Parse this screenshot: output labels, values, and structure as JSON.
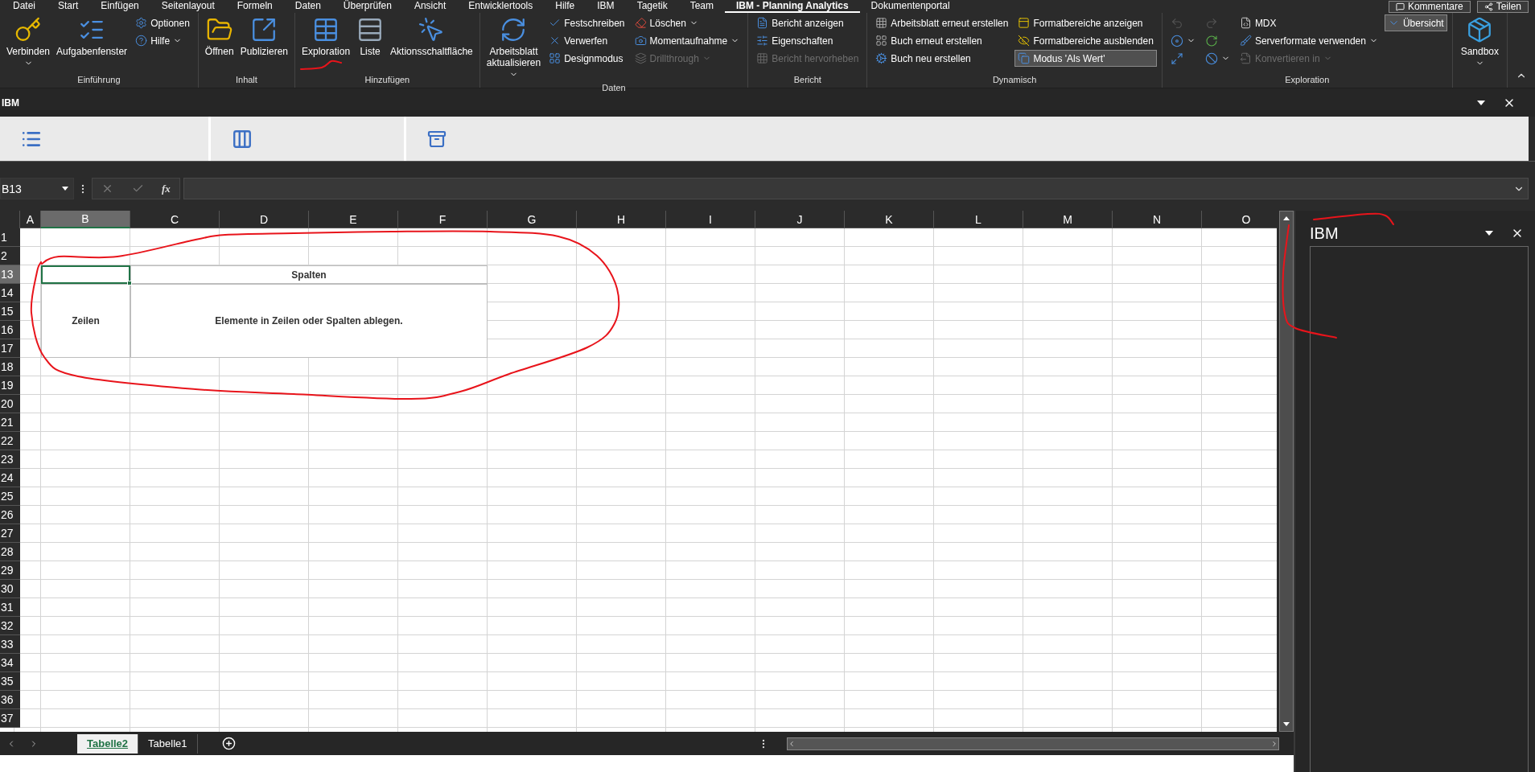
{
  "menu_tabs": [
    {
      "label": "Datei",
      "selected": false
    },
    {
      "label": "Start",
      "selected": false
    },
    {
      "label": "Einfügen",
      "selected": false
    },
    {
      "label": "Seitenlayout",
      "selected": false
    },
    {
      "label": "Formeln",
      "selected": false
    },
    {
      "label": "Daten",
      "selected": false
    },
    {
      "label": "Überprüfen",
      "selected": false
    },
    {
      "label": "Ansicht",
      "selected": false
    },
    {
      "label": "Entwicklertools",
      "selected": false
    },
    {
      "label": "Hilfe",
      "selected": false
    },
    {
      "label": "IBM",
      "selected": false
    },
    {
      "label": "Tagetik",
      "selected": false
    },
    {
      "label": "Team",
      "selected": false
    },
    {
      "label": "IBM - Planning Analytics",
      "selected": true
    },
    {
      "label": "Dokumentenportal",
      "selected": false
    }
  ],
  "top_buttons": [
    "Kommentare",
    "Teilen"
  ],
  "ribbon": {
    "groups": [
      {
        "label": "Einführung",
        "columns": [
          {
            "kind": "large",
            "items": [
              {
                "label": "Verbinden",
                "dropdown": true,
                "disabled": false
              }
            ]
          },
          {
            "kind": "large",
            "items": [
              {
                "label": "Aufgabenfenster",
                "dropdown": false,
                "disabled": false
              }
            ]
          },
          {
            "kind": "stack",
            "items": [
              {
                "label": "Optionen",
                "dropdown": false,
                "disabled": false
              },
              {
                "label": "Hilfe",
                "dropdown": true,
                "disabled": false
              }
            ]
          }
        ]
      },
      {
        "label": "Inhalt",
        "columns": [
          {
            "kind": "large",
            "items": [
              {
                "label": "Öffnen",
                "dropdown": false,
                "disabled": false
              }
            ]
          },
          {
            "kind": "large",
            "items": [
              {
                "label": "Publizieren",
                "dropdown": false,
                "disabled": false
              }
            ]
          }
        ]
      },
      {
        "label": "Hinzufügen",
        "columns": [
          {
            "kind": "large",
            "items": [
              {
                "label": "Exploration",
                "dropdown": false,
                "disabled": false
              }
            ]
          },
          {
            "kind": "large",
            "items": [
              {
                "label": "Liste",
                "dropdown": false,
                "disabled": false
              }
            ]
          },
          {
            "kind": "large",
            "items": [
              {
                "label": "Aktionsschaltfläche",
                "dropdown": false,
                "disabled": false
              }
            ]
          }
        ]
      },
      {
        "label": "Daten",
        "columns": [
          {
            "kind": "large",
            "items": [
              {
                "label": "Arbeitsblatt aktualisieren",
                "dropdown": true,
                "disabled": false
              }
            ]
          },
          {
            "kind": "stack",
            "items": [
              {
                "label": "Festschreiben",
                "dropdown": false,
                "disabled": false
              },
              {
                "label": "Verwerfen",
                "dropdown": false,
                "disabled": false
              },
              {
                "label": "Designmodus",
                "dropdown": false,
                "disabled": false
              }
            ]
          },
          {
            "kind": "stack",
            "items": [
              {
                "label": "Löschen",
                "dropdown": true,
                "disabled": false
              },
              {
                "label": "Momentaufnahme",
                "dropdown": true,
                "disabled": false
              },
              {
                "label": "Drillthrough",
                "dropdown": true,
                "disabled": true
              }
            ]
          }
        ]
      },
      {
        "label": "Bericht",
        "columns": [
          {
            "kind": "stack",
            "items": [
              {
                "label": "Bericht anzeigen",
                "dropdown": false,
                "disabled": false
              },
              {
                "label": "Eigenschaften",
                "dropdown": false,
                "disabled": false
              },
              {
                "label": "Bericht hervorheben",
                "dropdown": false,
                "disabled": true
              }
            ]
          }
        ]
      },
      {
        "label": "Dynamisch",
        "columns": [
          {
            "kind": "stack",
            "items": [
              {
                "label": "Arbeitsblatt erneut erstellen",
                "dropdown": false,
                "disabled": false
              },
              {
                "label": "Buch erneut erstellen",
                "dropdown": false,
                "disabled": false
              },
              {
                "label": "Buch neu erstellen",
                "dropdown": false,
                "disabled": false
              }
            ]
          },
          {
            "kind": "stack",
            "items": [
              {
                "label": "Formatbereiche anzeigen",
                "dropdown": false,
                "disabled": false
              },
              {
                "label": "Formatbereiche ausblenden",
                "dropdown": false,
                "disabled": false
              },
              {
                "label": "Modus 'Als Wert'",
                "dropdown": false,
                "disabled": false,
                "pressed": true
              }
            ]
          }
        ]
      },
      {
        "label": "Exploration",
        "columns": [
          {
            "kind": "icons",
            "items": [
              {
                "dropdown": false,
                "disabled": true
              },
              {
                "dropdown": true,
                "disabled": false
              },
              {
                "dropdown": false,
                "disabled": false
              }
            ]
          },
          {
            "kind": "icons",
            "items": [
              {
                "dropdown": false,
                "disabled": true
              },
              {
                "dropdown": false,
                "disabled": false
              },
              {
                "dropdown": true,
                "disabled": false
              }
            ]
          },
          {
            "kind": "stack",
            "items": [
              {
                "label": "MDX",
                "dropdown": false,
                "disabled": false
              },
              {
                "label": "Serverformate verwenden",
                "dropdown": true,
                "disabled": false
              },
              {
                "label": "Konvertieren in",
                "dropdown": true,
                "disabled": true
              }
            ]
          },
          {
            "kind": "stack",
            "items": [
              {
                "label": "Übersicht",
                "dropdown": false,
                "disabled": false,
                "pressed": true
              }
            ]
          }
        ]
      },
      {
        "columns": [
          {
            "kind": "large",
            "items": [
              {
                "label": "Sandbox",
                "dropdown": true,
                "disabled": false
              }
            ]
          }
        ]
      }
    ]
  },
  "task_pane": {
    "title": "IBM"
  },
  "formula_bar": {
    "name_box": "B13",
    "function_label": "fx"
  },
  "sheet": {
    "columns": [
      {
        "label": "A",
        "selected": false
      },
      {
        "label": "B",
        "selected": true
      },
      {
        "label": "C",
        "selected": false
      },
      {
        "label": "D",
        "selected": false
      },
      {
        "label": "E",
        "selected": false
      },
      {
        "label": "F",
        "selected": false
      },
      {
        "label": "G",
        "selected": false
      },
      {
        "label": "H",
        "selected": false
      },
      {
        "label": "I",
        "selected": false
      },
      {
        "label": "J",
        "selected": false
      },
      {
        "label": "K",
        "selected": false
      },
      {
        "label": "L",
        "selected": false
      },
      {
        "label": "M",
        "selected": false
      },
      {
        "label": "N",
        "selected": false
      },
      {
        "label": "O",
        "selected": false
      }
    ],
    "rows": [
      {
        "label": "1",
        "selected": false
      },
      {
        "label": "2",
        "selected": false
      },
      {
        "label": "13",
        "selected": true
      },
      {
        "label": "14",
        "selected": false
      },
      {
        "label": "15",
        "selected": false
      },
      {
        "label": "16",
        "selected": false
      },
      {
        "label": "17",
        "selected": false
      },
      {
        "label": "18",
        "selected": false
      },
      {
        "label": "19",
        "selected": false
      },
      {
        "label": "20",
        "selected": false
      },
      {
        "label": "21",
        "selected": false
      },
      {
        "label": "22",
        "selected": false
      },
      {
        "label": "23",
        "selected": false
      },
      {
        "label": "24",
        "selected": false
      },
      {
        "label": "25",
        "selected": false
      },
      {
        "label": "26",
        "selected": false
      },
      {
        "label": "27",
        "selected": false
      },
      {
        "label": "28",
        "selected": false
      },
      {
        "label": "29",
        "selected": false
      },
      {
        "label": "30",
        "selected": false
      },
      {
        "label": "31",
        "selected": false
      },
      {
        "label": "32",
        "selected": false
      },
      {
        "label": "33",
        "selected": false
      },
      {
        "label": "34",
        "selected": false
      },
      {
        "label": "35",
        "selected": false
      },
      {
        "label": "36",
        "selected": false
      },
      {
        "label": "37",
        "selected": false
      }
    ],
    "pivot": {
      "columns_label": "Spalten",
      "rows_label": "Zeilen",
      "hint": "Elemente in Zeilen oder Spalten ablegen."
    }
  },
  "sheet_tabs": [
    {
      "label": "Tabelle2",
      "selected": true
    },
    {
      "label": "Tabelle1",
      "selected": false
    }
  ],
  "side_pane": {
    "title": "IBM"
  }
}
